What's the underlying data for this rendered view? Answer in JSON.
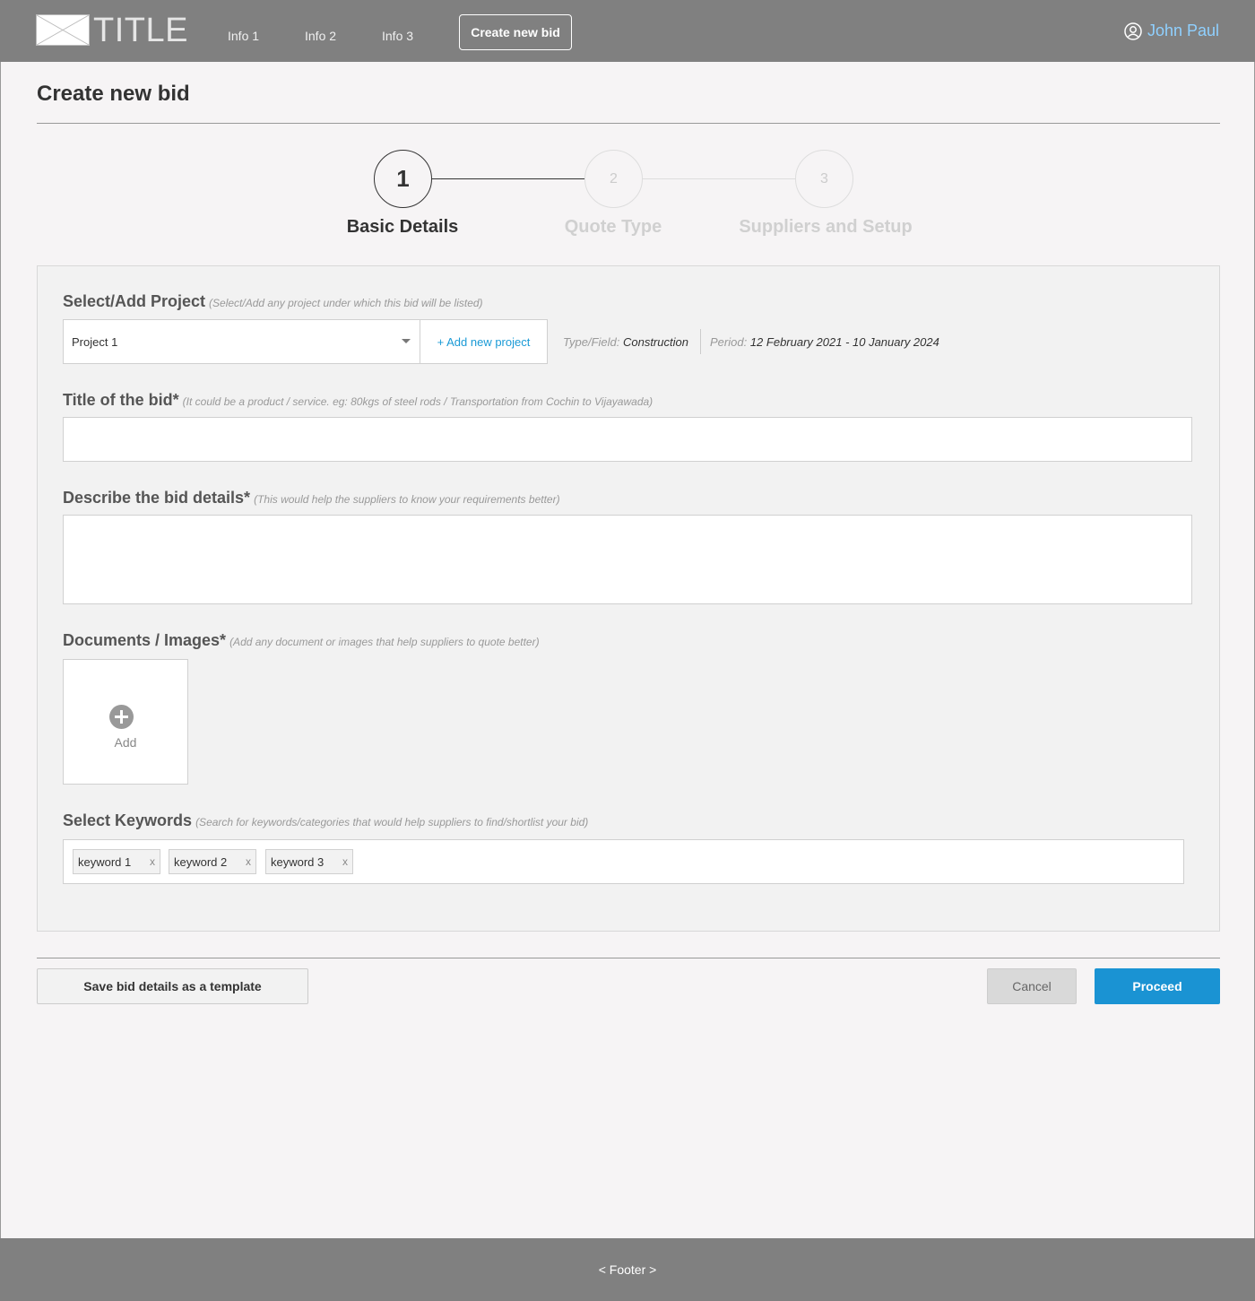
{
  "header": {
    "logo_icon": "image-placeholder-icon",
    "title": "TITLE",
    "nav": [
      "Info 1",
      "Info 2",
      "Info 3"
    ],
    "create_button": "Create new bid",
    "user": {
      "icon": "user-circle-icon",
      "name": "John Paul",
      "name_color": "#8fd0ff"
    }
  },
  "page": {
    "title": "Create new bid"
  },
  "stepper": {
    "steps": [
      {
        "number": "1",
        "label": "Basic Details",
        "active": true
      },
      {
        "number": "2",
        "label": "Quote Type",
        "active": false
      },
      {
        "number": "3",
        "label": "Suppliers and Setup",
        "active": false
      }
    ]
  },
  "form": {
    "project": {
      "label": "Select/Add Project",
      "hint": "(Select/Add any project under which this bid will be listed)",
      "selected": "Project 1",
      "add_button": "+ Add new project",
      "type_label": "Type/Field:",
      "type_value": "Construction",
      "period_label": "Period:",
      "period_value": "12 February 2021 - 10 January 2024"
    },
    "title": {
      "label": "Title of the bid*",
      "hint": "(It could be a product / service. eg: 80kgs of steel rods / Transportation from Cochin to Vijayawada)",
      "value": ""
    },
    "description": {
      "label": "Describe the bid details*",
      "hint": "(This would help the suppliers to know your requirements better)",
      "value": ""
    },
    "documents": {
      "label": "Documents / Images*",
      "hint": "(Add any document or images that help suppliers to quote better)",
      "add_label": "Add",
      "add_icon": "plus-circle-icon"
    },
    "keywords": {
      "label": "Select Keywords",
      "hint": "(Search for keywords/categories that would help suppliers to find/shortlist your bid)",
      "chips": [
        "keyword 1",
        "keyword 2",
        "keyword 3"
      ],
      "remove_symbol": "x"
    }
  },
  "actions": {
    "template": "Save bid details as a template",
    "cancel": "Cancel",
    "proceed": "Proceed",
    "proceed_color": "#1a93d3"
  },
  "footer": {
    "text": "< Footer >"
  }
}
